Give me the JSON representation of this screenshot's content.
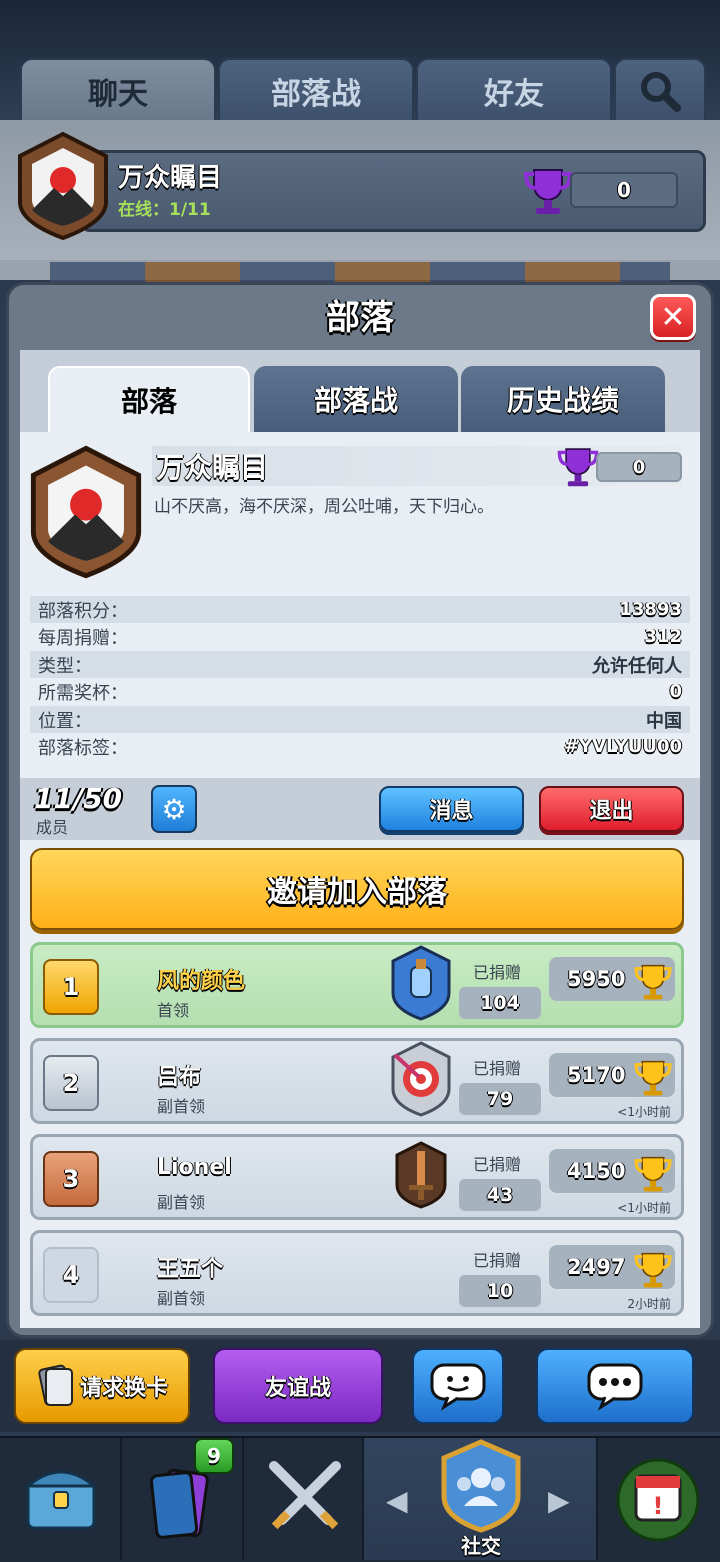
{
  "top_tabs": [
    {
      "label": "聊天"
    },
    {
      "label": "部落战"
    },
    {
      "label": "好友"
    }
  ],
  "top_clan": {
    "name": "万众瞩目",
    "online": "在线：1/11",
    "trophies": "0"
  },
  "modal": {
    "title": "部落",
    "tabs": [
      {
        "label": "部落"
      },
      {
        "label": "部落战"
      },
      {
        "label": "历史战绩"
      }
    ],
    "clan": {
      "name": "万众瞩目",
      "description": "山不厌高，海不厌深，周公吐哺，天下归心。",
      "trophies": "0"
    },
    "stats": [
      {
        "label": "部落积分：",
        "value": "13893"
      },
      {
        "label": "每周捐赠：",
        "value": "312"
      },
      {
        "label": "类型：",
        "value": "允许任何人"
      },
      {
        "label": "所需奖杯：",
        "value": "0"
      },
      {
        "label": "位置：",
        "value": "中国"
      },
      {
        "label": "部落标签：",
        "value": "#YVLYUU00"
      }
    ],
    "members_count": "11/50",
    "members_label": "成员",
    "message_button": "消息",
    "leave_button": "退出",
    "invite_button": "邀请加入部落",
    "members": [
      {
        "rank": "1",
        "name": "风的颜色",
        "role": "首领",
        "donated_label": "已捐赠",
        "donated": "104",
        "trophies": "5950",
        "last_seen": ""
      },
      {
        "rank": "2",
        "name": "吕布",
        "role": "副首领",
        "donated_label": "已捐赠",
        "donated": "79",
        "trophies": "5170",
        "last_seen": "<1小时前"
      },
      {
        "rank": "3",
        "name": "Lionel",
        "role": "副首领",
        "donated_label": "已捐赠",
        "donated": "43",
        "trophies": "4150",
        "last_seen": "<1小时前"
      },
      {
        "rank": "4",
        "name": "王五个",
        "role": "副首领",
        "donated_label": "已捐赠",
        "donated": "10",
        "trophies": "2497",
        "last_seen": "2小时前"
      }
    ]
  },
  "actions": {
    "request_cards": "请求换卡",
    "friendly_battle": "友谊战"
  },
  "nav": {
    "cards_badge": "9",
    "social_label": "社交"
  },
  "colors": {
    "accent_gold": "#ffb019",
    "accent_blue": "#1f82e0",
    "accent_red": "#e01e2e",
    "purple": "#8e2fd8"
  }
}
